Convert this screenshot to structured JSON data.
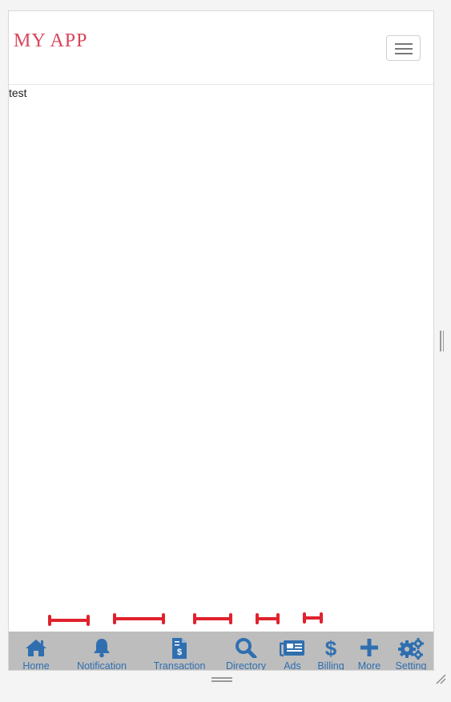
{
  "app": {
    "brand": "MY APP"
  },
  "content": {
    "text": "test"
  },
  "colors": {
    "brand": "#d9455a",
    "nav_accent": "#2f6fb0",
    "nav_bg": "#bdbdbd",
    "marker": "#e0222e"
  },
  "bottom_nav": {
    "items": [
      {
        "label": "Home",
        "icon": "home-icon"
      },
      {
        "label": "Notification",
        "icon": "bell-icon"
      },
      {
        "label": "Transaction",
        "icon": "invoice-icon"
      },
      {
        "label": "Directory",
        "icon": "search-icon"
      },
      {
        "label": "Ads",
        "icon": "newspaper-icon"
      },
      {
        "label": "Billing",
        "icon": "dollar-icon"
      },
      {
        "label": "More",
        "icon": "plus-icon"
      },
      {
        "label": "Setting",
        "icon": "gears-icon"
      }
    ]
  }
}
